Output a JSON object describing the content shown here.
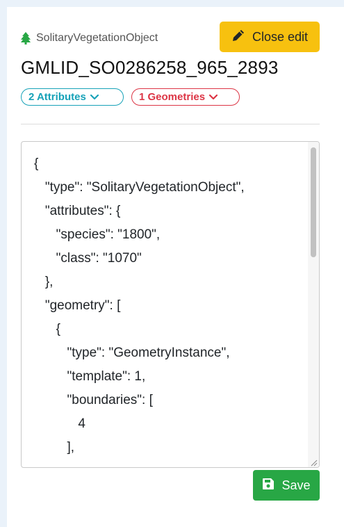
{
  "object": {
    "type_label": "SolitaryVegetationObject",
    "type_icon": "tree-icon",
    "id": "GMLID_SO0286258_965_2893"
  },
  "actions": {
    "close_edit_label": "Close edit",
    "close_edit_icon": "pencil-icon",
    "save_label": "Save",
    "save_icon": "floppy-disk-icon"
  },
  "badges": {
    "attributes_label": "2 Attributes",
    "geometries_label": "1 Geometries"
  },
  "editor": {
    "content": "{\n   \"type\": \"SolitaryVegetationObject\",\n   \"attributes\": {\n      \"species\": \"1800\",\n      \"class\": \"1070\"\n   },\n   \"geometry\": [\n      {\n         \"type\": \"GeometryInstance\",\n         \"template\": 1,\n         \"boundaries\": [\n            4\n         ],"
  },
  "colors": {
    "close_edit_bg": "#f7c10f",
    "attributes_badge": "#17a2b8",
    "geometries_badge": "#dc3545",
    "save_bg": "#28a745",
    "tree_icon": "#28a745"
  }
}
